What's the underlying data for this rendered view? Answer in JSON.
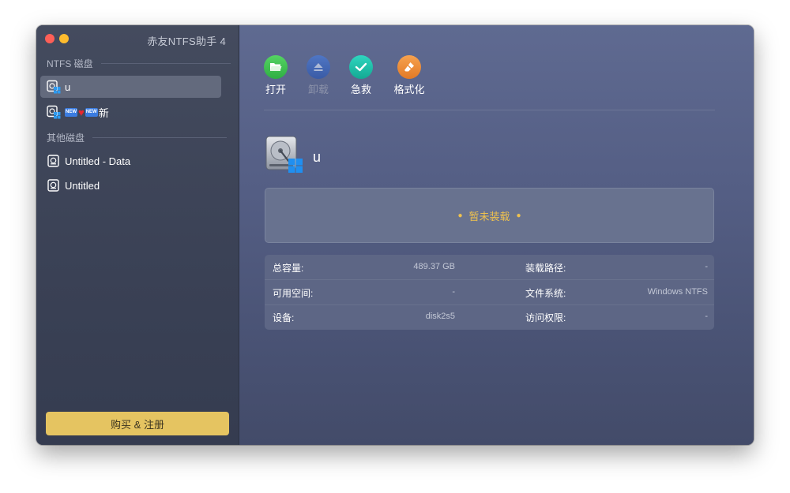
{
  "app": {
    "title": "赤友NTFS助手 4"
  },
  "sidebar": {
    "ntfs_section": "NTFS 磁盘",
    "other_section": "其他磁盘",
    "ntfs_disks": [
      {
        "name": "u",
        "selected": true,
        "icon": "ntfs-disk-icon"
      },
      {
        "name_suffix": "新",
        "icon": "ntfs-disk-icon",
        "emoji": [
          "🆕",
          "❤️",
          "🆕"
        ]
      }
    ],
    "other_disks": [
      {
        "name": "Untitled - Data",
        "icon": "apfs-disk-icon"
      },
      {
        "name": "Untitled",
        "icon": "apfs-disk-icon"
      }
    ],
    "buy_button": "购买 & 注册"
  },
  "toolbar": {
    "open": "打开",
    "unmount": "卸载",
    "rescue": "急救",
    "format": "格式化"
  },
  "volume": {
    "name": "u",
    "status": "暂未装载"
  },
  "info": {
    "total_capacity_label": "总容量:",
    "total_capacity_value": "489.37 GB",
    "free_space_label": "可用空间:",
    "free_space_value": "-",
    "device_label": "设备:",
    "device_value": "disk2s5",
    "mount_path_label": "装载路径:",
    "mount_path_value": "-",
    "filesystem_label": "文件系统:",
    "filesystem_value": "Windows NTFS",
    "permission_label": "访问权限:",
    "permission_value": "-"
  },
  "colors": {
    "accent_yellow": "#e5c461",
    "status_text": "#f0c24e",
    "open_green": "#3ec552",
    "unmount_blue": "#3d6bc9",
    "rescue_teal": "#1fc1a8",
    "format_orange": "#f08c35"
  }
}
